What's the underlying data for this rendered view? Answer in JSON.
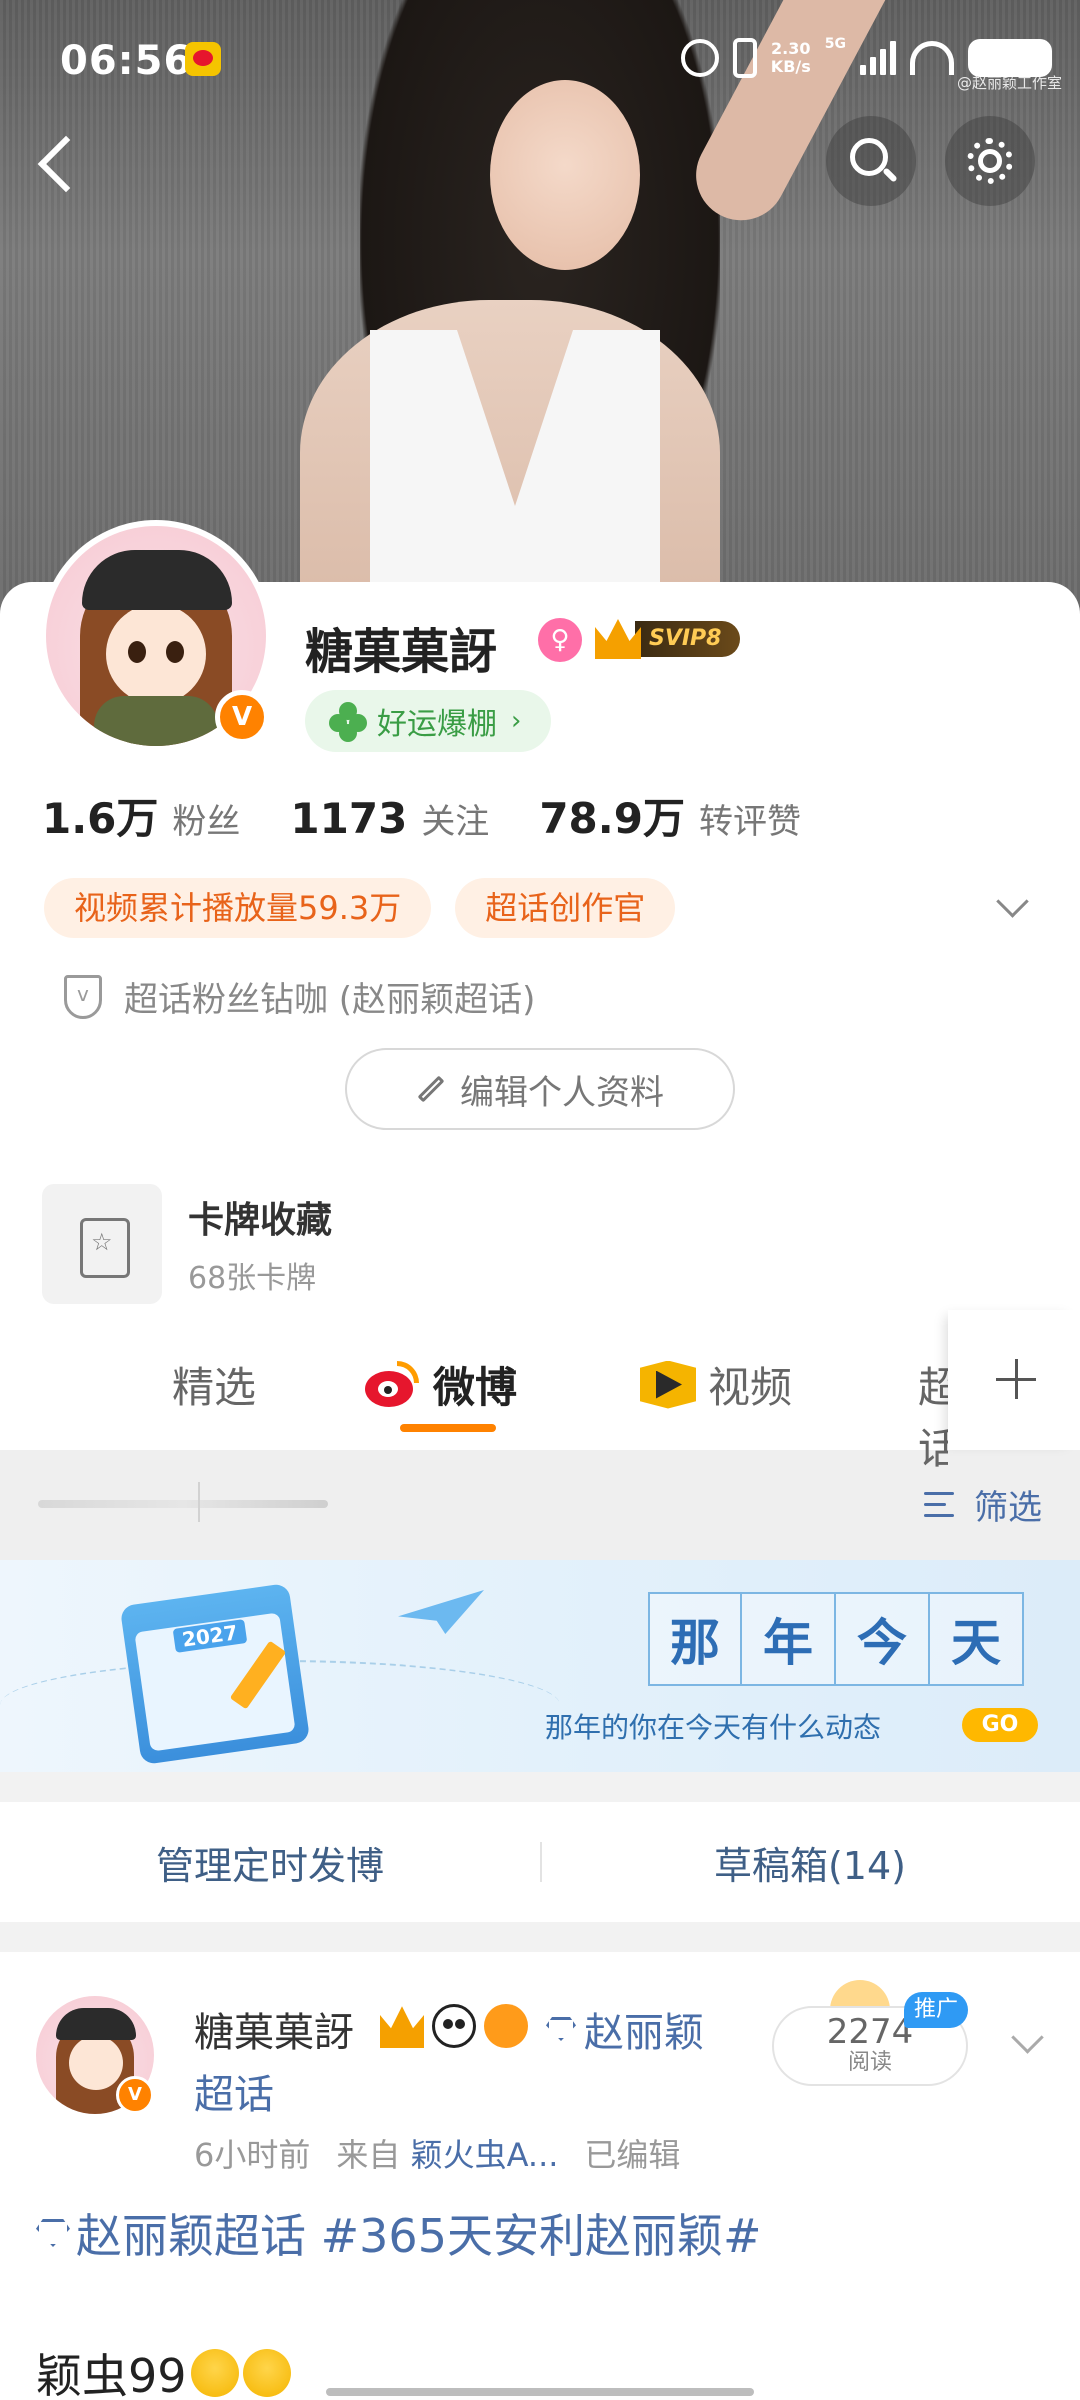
{
  "status_bar": {
    "time": "06:56",
    "speed_value": "2.30",
    "speed_unit": "KB/s",
    "network": "5G"
  },
  "cover": {
    "watermark": "@赵丽颖工作室"
  },
  "profile": {
    "nickname": "糖菓菓訝",
    "svip_label": "SVIP8",
    "luck_label": "好运爆棚",
    "luck_chevron": "›",
    "verified_mark": "V",
    "stats": [
      {
        "value": "1.6万",
        "label": "粉丝"
      },
      {
        "value": "1173",
        "label": "关注"
      },
      {
        "value": "78.9万",
        "label": "转评赞"
      }
    ],
    "tags": [
      "视频累计播放量59.3万",
      "超话创作官"
    ],
    "fan_badge": "超话粉丝钻咖 (赵丽颖超话)",
    "edit_button": "编辑个人资料",
    "card": {
      "title": "卡牌收藏",
      "subtitle": "68张卡牌"
    }
  },
  "tabs": {
    "items": [
      "精选",
      "微博",
      "视频",
      "超话"
    ],
    "active": "微博"
  },
  "filter": {
    "label": "筛选"
  },
  "banner": {
    "calendar_year": "2027",
    "title_chars": [
      "那",
      "年",
      "今",
      "天"
    ],
    "subtitle": "那年的你在今天有什么动态",
    "go": "GO"
  },
  "manage": {
    "scheduled": "管理定时发博",
    "drafts": "草稿箱(14)"
  },
  "post": {
    "author": "糖菓菓訝",
    "topic_part1": "赵丽颖",
    "topic_part2": "超话",
    "time": "6小时前",
    "source_prefix": "来自",
    "source": "颖火虫A...",
    "edited": "已编辑",
    "reads": "2274",
    "reads_label": "阅读",
    "promo": "推广",
    "body_line1": "赵丽颖超话 #365天安利赵丽颖#",
    "body_line2": "颖虫99"
  }
}
